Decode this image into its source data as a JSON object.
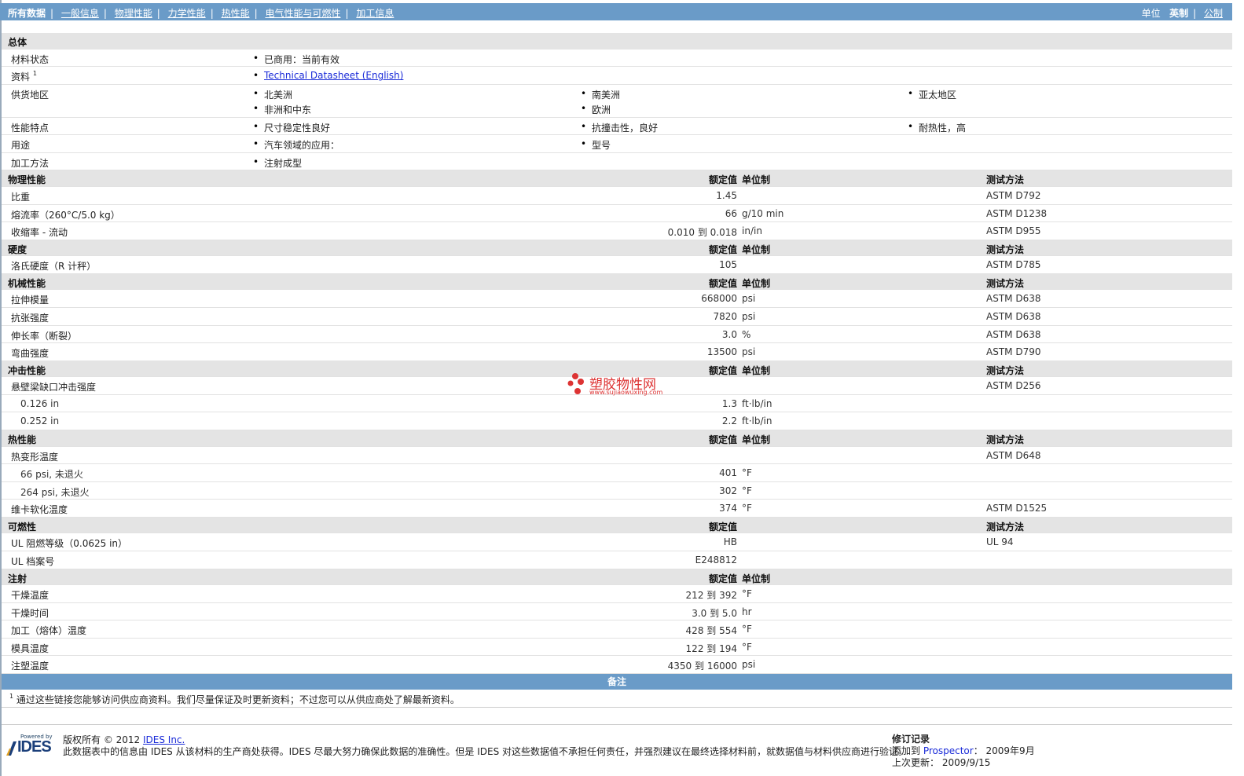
{
  "nav": {
    "tabs": [
      "所有数据",
      "一般信息",
      "物理性能",
      "力学性能",
      "热性能",
      "电气性能与可燃性",
      "加工信息"
    ],
    "units_label": "单位",
    "unit_options": [
      "英制",
      "公制"
    ]
  },
  "general": {
    "title": "总体",
    "status_label": "材料状态",
    "status_value": "已商用：当前有效",
    "docs_label": "资料",
    "docs_sup": "1",
    "docs_link": "Technical Datasheet (English)",
    "supply_label": "供货地区",
    "supply": [
      "北美洲",
      "南美洲",
      "亚太地区",
      "非洲和中东",
      "欧洲"
    ],
    "features_label": "性能特点",
    "features": [
      "尺寸稳定性良好",
      "抗撞击性，良好",
      "耐热性，高"
    ],
    "uses_label": "用途",
    "uses": [
      "汽车领域的应用：",
      "型号"
    ],
    "process_label": "加工方法",
    "process": [
      "注射成型"
    ]
  },
  "headers": {
    "nominal": "额定值",
    "unit": "单位制",
    "test": "测试方法"
  },
  "physical": {
    "title": "物理性能",
    "rows": [
      {
        "name": "比重",
        "value": "1.45",
        "unit": "",
        "test": "ASTM D792"
      },
      {
        "name": "熔流率（260°C/5.0 kg）",
        "value": "66",
        "unit": "g/10 min",
        "test": "ASTM D1238"
      },
      {
        "name": "收缩率 - 流动",
        "value": "0.010 到  0.018",
        "unit": "in/in",
        "test": "ASTM D955"
      }
    ]
  },
  "hardness": {
    "title": "硬度",
    "rows": [
      {
        "name": "洛氏硬度（R 计秤）",
        "value": "105",
        "unit": "",
        "test": "ASTM D785"
      }
    ]
  },
  "mechanical": {
    "title": "机械性能",
    "rows": [
      {
        "name": "拉伸模量",
        "value": "668000",
        "unit": "psi",
        "test": "ASTM D638"
      },
      {
        "name": "抗张强度",
        "value": "7820",
        "unit": "psi",
        "test": "ASTM D638"
      },
      {
        "name": "伸长率（断裂）",
        "value": "3.0",
        "unit": "%",
        "test": "ASTM D638"
      },
      {
        "name": "弯曲强度",
        "value": "13500",
        "unit": "psi",
        "test": "ASTM D790"
      }
    ]
  },
  "impact": {
    "title": "冲击性能",
    "main": {
      "name": "悬壁梁缺口冲击强度",
      "test": "ASTM D256"
    },
    "rows": [
      {
        "name": "0.126 in",
        "value": "1.3",
        "unit": "ft·lb/in"
      },
      {
        "name": "0.252 in",
        "value": "2.2",
        "unit": "ft·lb/in"
      }
    ]
  },
  "thermal": {
    "title": "热性能",
    "main": {
      "name": "热变形温度",
      "test": "ASTM D648"
    },
    "rows": [
      {
        "name": "66 psi, 未退火",
        "value": "401",
        "unit": "°F"
      },
      {
        "name": "264 psi, 未退火",
        "value": "302",
        "unit": "°F"
      }
    ],
    "vicat": {
      "name": "维卡软化温度",
      "value": "374",
      "unit": "°F",
      "test": "ASTM D1525"
    }
  },
  "flammability": {
    "title": "可燃性",
    "rows": [
      {
        "name": "UL 阻燃等级（0.0625 in）",
        "value": "HB",
        "test": "UL 94"
      },
      {
        "name": "UL 档案号",
        "value": "E248812",
        "test": ""
      }
    ]
  },
  "injection": {
    "title": "注射",
    "rows": [
      {
        "name": "干燥温度",
        "value": "212 到  392",
        "unit": "°F"
      },
      {
        "name": "干燥时间",
        "value": "3.0 到  5.0",
        "unit": "hr"
      },
      {
        "name": "加工（熔体）温度",
        "value": "428 到  554",
        "unit": "°F"
      },
      {
        "name": "模具温度",
        "value": "122 到  194",
        "unit": "°F"
      },
      {
        "name": "注塑温度",
        "value": "4350 到  16000",
        "unit": "psi"
      }
    ]
  },
  "notes": {
    "title": "备注",
    "sup": "1",
    "text": "通过这些链接您能够访问供应商资料。我们尽量保证及时更新资料；不过您可以从供应商处了解最新资料。"
  },
  "footer": {
    "powered_by": "Powered by",
    "logo": "IDES",
    "copyright": "版权所有 © 2012 ",
    "company": "IDES Inc.",
    "disclaimer": "此数据表中的信息由 IDES 从该材料的生产商处获得。IDES 尽最大努力确保此数据的准确性。但是 IDES 对这些数据值不承担任何责任，并强烈建议在最终选择材料前，就数据值与材料供应商进行验证。",
    "rev_title": "修订记录",
    "added_label": "添加到 ",
    "added_source": "Prospector",
    "added_value": "：  2009年9月",
    "updated_label": "上次更新：",
    "updated_value": "  2009/9/15"
  },
  "watermark": {
    "text": "塑胶物性网",
    "url": "www.sujiaowuxing.com"
  },
  "colors": {
    "nav_bg": "#6a9bc8",
    "section_bg": "#e4e4e4",
    "link": "#1a2bd8",
    "watermark": "#dd3333"
  }
}
